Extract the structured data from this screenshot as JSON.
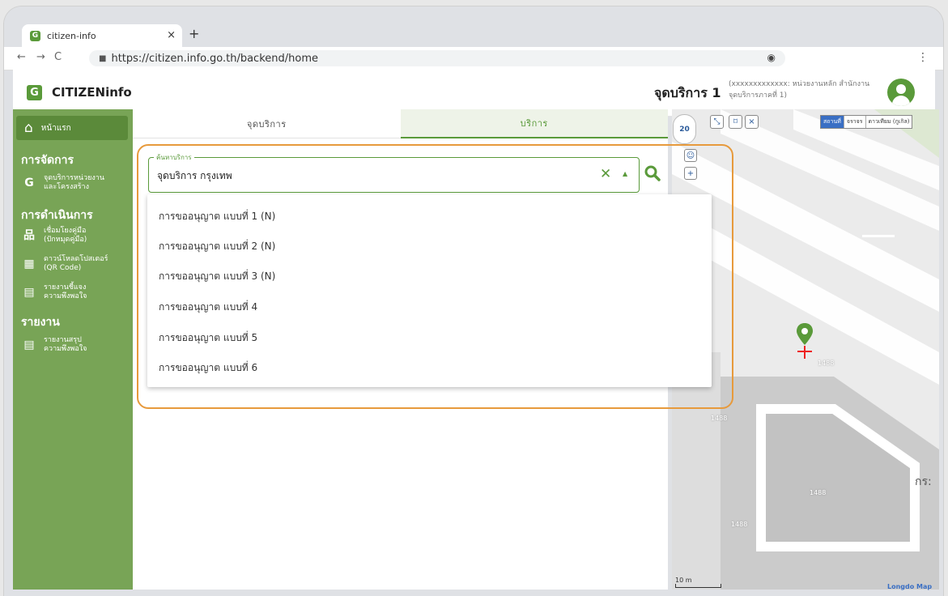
{
  "browser": {
    "tab_title": "citizen-info",
    "tab_favicon": "G",
    "tab_close": "×",
    "new_tab": "+",
    "url": "https://citizen.info.go.th/backend/home"
  },
  "header": {
    "logo_letter": "G",
    "app_name": "CITIZENinfo",
    "service_title": "จุดบริการ 1",
    "user_line1": "(xxxxxxxxxxxxx: หน่วยงานหลัก สำนักงาน",
    "user_line2": "จุดบริการภาคที่ 1)"
  },
  "sidebar": {
    "home_label": "หน้าแรก",
    "section_manage": "การจัดการ",
    "manage_item_line1": "จุดบริการหน่วยงาน",
    "manage_item_line2": "และโครงสร้าง",
    "section_ops": "การดำเนินการ",
    "ops_item1_line1": "เชื่อมโยงคู่มือ",
    "ops_item1_line2": "(ปักหมุดคู่มือ)",
    "ops_item2_line1": "ดาวน์โหลดโปสเตอร์",
    "ops_item2_line2": "(QR Code)",
    "ops_item3_line1": "รายงานชี้แจง",
    "ops_item3_line2": "ความพึงพอใจ",
    "section_report": "รายงาน",
    "report_item_line1": "รายงานสรุป",
    "report_item_line2": "ความพึงพอใจ"
  },
  "main": {
    "tab_service_point": "จุดบริการ",
    "tab_service": "บริการ",
    "search_label": "ค้นหาบริการ",
    "search_value": "จุดบริการ กรุงเทพ",
    "options": [
      "การขออนุญาต แบบที่ 1 (N)",
      "การขออนุญาต แบบที่ 2 (N)",
      "การขออนุญาต แบบที่ 3 (N)",
      "การขออนุญาต แบบที่ 4",
      "การขออนุญาต แบบที่ 5",
      "การขออนุญาต แบบที่ 6"
    ]
  },
  "map": {
    "zoom_level": "20",
    "layer_place": "สถานที่",
    "layer_traffic": "จราจร",
    "layer_satellite": "ดาวเทียม (กูเกิล)",
    "label_1488": "1488",
    "thai_fragment": "กร:",
    "scale_text": "10 m",
    "brand": "Longdo Map"
  },
  "colors": {
    "brand_green": "#5a9a3a",
    "sidebar_green": "#78a456",
    "highlight_orange": "#e79a3c"
  }
}
